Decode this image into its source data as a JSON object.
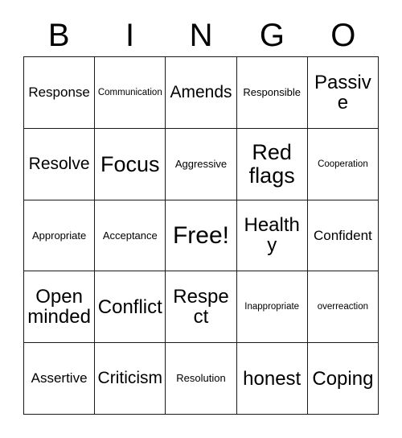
{
  "card": {
    "title": "BINGO",
    "header_letters": [
      "B",
      "I",
      "N",
      "G",
      "O"
    ],
    "colors": {
      "background": "#ffffff",
      "border": "#1a1a1a",
      "text": "#000000"
    },
    "rows": [
      [
        {
          "label": "Response",
          "size": "md"
        },
        {
          "label": "Communication",
          "size": "xs"
        },
        {
          "label": "Amends",
          "size": "lg"
        },
        {
          "label": "Responsible",
          "size": "sm"
        },
        {
          "label": "Passive",
          "size": "xl"
        }
      ],
      [
        {
          "label": "Resolve",
          "size": "lg"
        },
        {
          "label": "Focus",
          "size": "2xl"
        },
        {
          "label": "Aggressive",
          "size": "sm"
        },
        {
          "label": "Red flags",
          "size": "2xl"
        },
        {
          "label": "Cooperation",
          "size": "xs"
        }
      ],
      [
        {
          "label": "Appropriate",
          "size": "sm"
        },
        {
          "label": "Acceptance",
          "size": "sm"
        },
        {
          "label": "Free!",
          "size": "3xl"
        },
        {
          "label": "Healthy",
          "size": "xl"
        },
        {
          "label": "Confident",
          "size": "md"
        }
      ],
      [
        {
          "label": "Open minded",
          "size": "xl"
        },
        {
          "label": "Conflict",
          "size": "xl"
        },
        {
          "label": "Respect",
          "size": "xl"
        },
        {
          "label": "Inappropriate",
          "size": "xs"
        },
        {
          "label": "overreaction",
          "size": "xs"
        }
      ],
      [
        {
          "label": "Assertive",
          "size": "md"
        },
        {
          "label": "Criticism",
          "size": "lg"
        },
        {
          "label": "Resolution",
          "size": "sm"
        },
        {
          "label": "honest",
          "size": "xl"
        },
        {
          "label": "Coping",
          "size": "xl"
        }
      ]
    ]
  }
}
